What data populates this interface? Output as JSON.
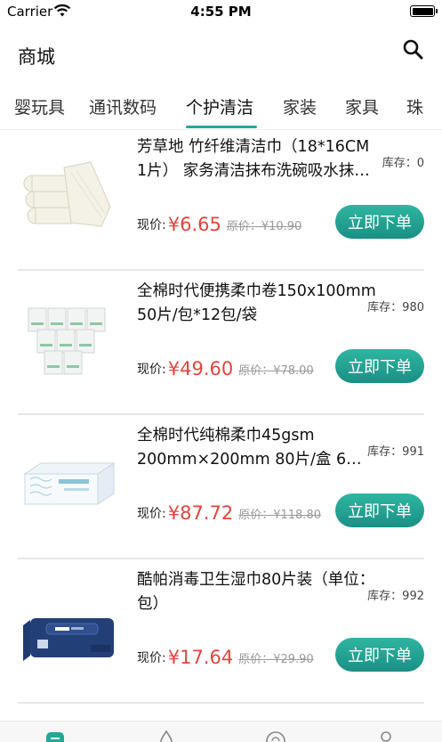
{
  "status": {
    "carrier": "Carrier",
    "time": "4:55 PM"
  },
  "nav": {
    "title": "商城"
  },
  "tabs": [
    "婴玩具",
    "通讯数码",
    "个护清洁",
    "家装",
    "家具",
    "珠"
  ],
  "products": [
    {
      "title": "芳草地 竹纤维清洁巾（18*16CM 1片） 家务清洁抹布洗碗吸水抹…",
      "stock_label": "库存：",
      "stock": "0",
      "now_label": "现价:",
      "price": "¥6.65",
      "orig": "原价：¥10.90",
      "buy": "立即下单"
    },
    {
      "title": "全棉时代便携柔巾卷150x100mm 50片/包*12包/袋",
      "stock_label": "库存：",
      "stock": "980",
      "now_label": "现价:",
      "price": "¥49.60",
      "orig": "原价：¥78.00",
      "buy": "立即下单"
    },
    {
      "title": "全棉时代纯棉柔巾45gsm 200mm×200mm 80片/盒 6…",
      "stock_label": "库存：",
      "stock": "991",
      "now_label": "现价:",
      "price": "¥87.72",
      "orig": "原价：¥118.80",
      "buy": "立即下单"
    },
    {
      "title": "酷帕消毒卫生湿巾80片装（单位：包）",
      "stock_label": "库存：",
      "stock": "992",
      "now_label": "现价:",
      "price": "¥17.64",
      "orig": "原价：¥29.90",
      "buy": "立即下单"
    }
  ],
  "colors": {
    "accent": "#23a896",
    "price": "#e2453c"
  },
  "icons": {
    "search": "search-icon",
    "wifi": "wifi-icon",
    "battery": "battery-icon"
  }
}
